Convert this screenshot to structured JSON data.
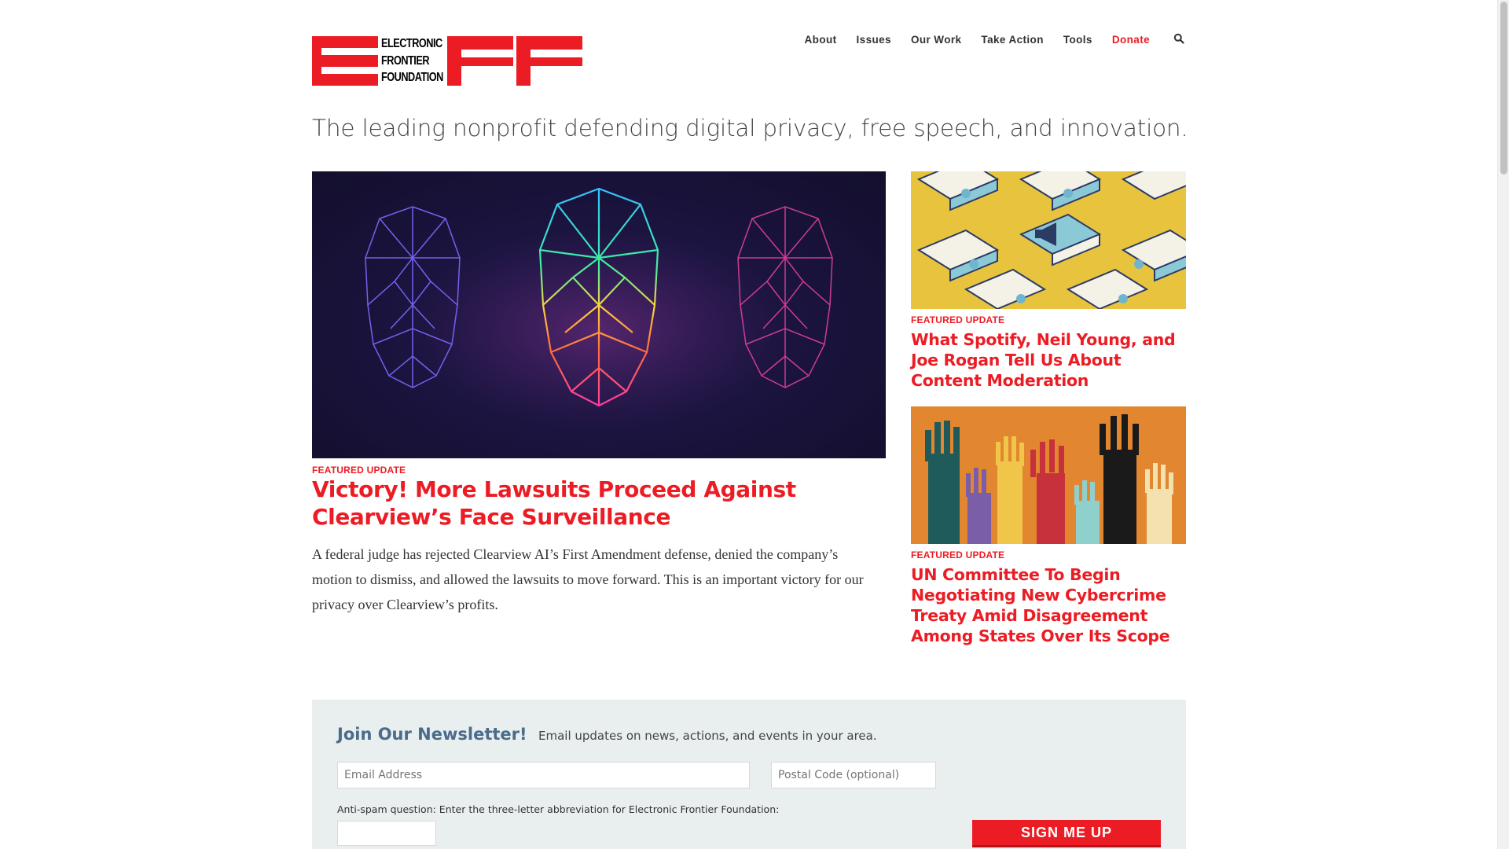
{
  "brand": {
    "logo_line1": "ELECTRONIC",
    "logo_line2": "FRONTIER",
    "logo_line3": "FOUNDATION",
    "accent_color": "#ec1c24"
  },
  "nav": {
    "items": [
      "About",
      "Issues",
      "Our Work",
      "Take Action",
      "Tools",
      "Donate"
    ],
    "search_icon": "search-icon"
  },
  "tagline": "The leading nonprofit defending digital privacy, free speech, and innovation.",
  "hero": {
    "image_icon": "wireframe-faces-image",
    "kicker": "FEATURED UPDATE",
    "title": "Victory! More Lawsuits Proceed Against Clearview’s Face Surveillance",
    "body": "A federal judge has rejected Clearview AI’s First Amendment defense, denied the company’s motion to dismiss, and allowed the lawsuits to move forward. This is an important victory for our privacy over Clearview’s profits."
  },
  "side_articles": [
    {
      "image_icon": "laptops-megaphone-image",
      "kicker": "FEATURED UPDATE",
      "title": "What Spotify, Neil Young, and Joe Rogan Tell Us About Content Moderation"
    },
    {
      "image_icon": "raised-hands-image",
      "kicker": "FEATURED UPDATE",
      "title": "UN Committee To Begin Negotiating New Cybercrime Treaty Amid Disagreement Among States Over Its Scope"
    }
  ],
  "newsletter": {
    "title": "Join Our Newsletter!",
    "subtitle": "Email updates on news, actions, and events in your area.",
    "email_placeholder": "Email Address",
    "postal_placeholder": "Postal Code (optional)",
    "antispam_label": "Anti-spam question: Enter the three-letter abbreviation for Electronic Frontier Foundation:",
    "answer_value": "",
    "submit_label": "SIGN ME UP"
  }
}
